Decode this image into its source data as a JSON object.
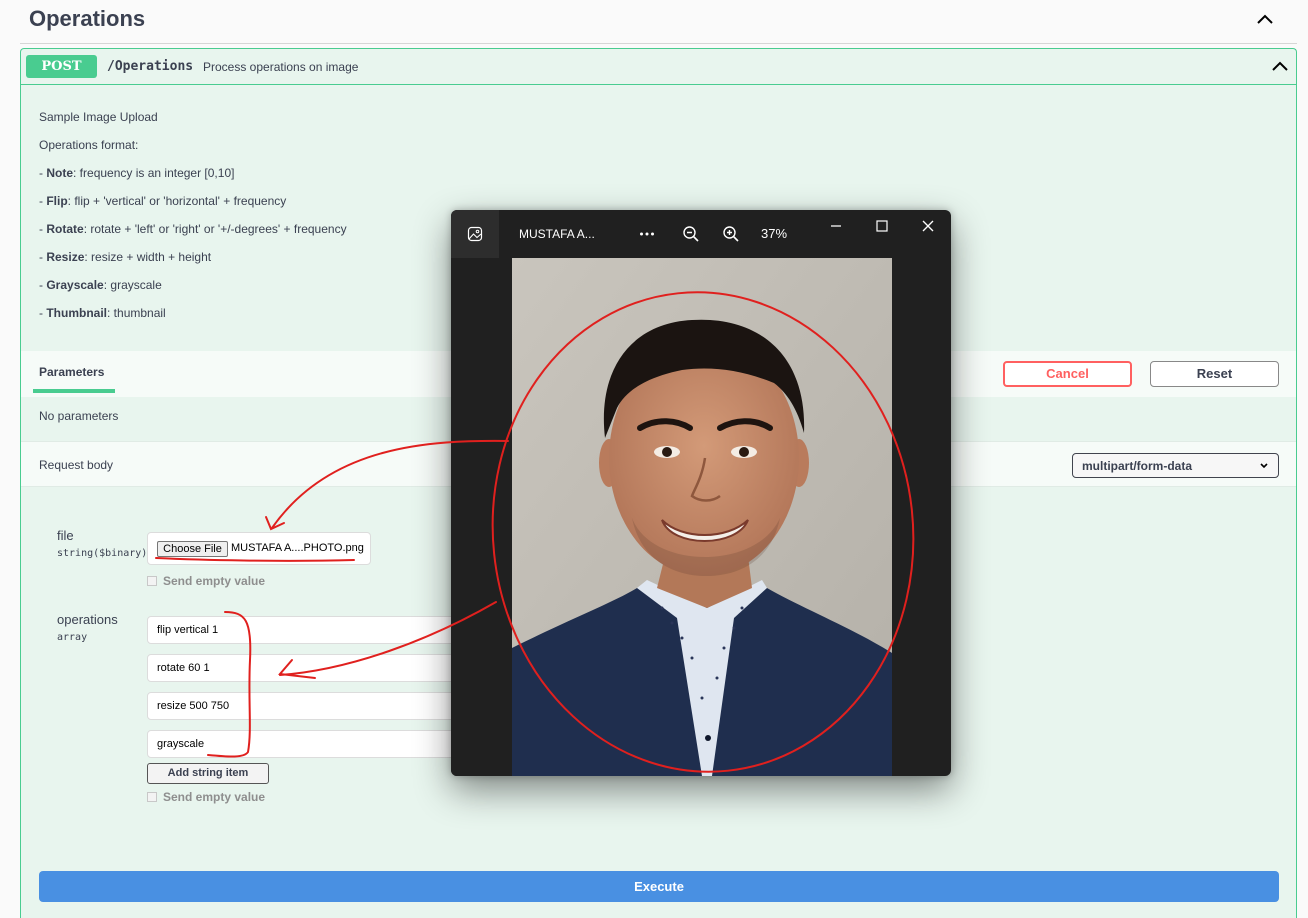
{
  "section": {
    "title": "Operations"
  },
  "endpoint": {
    "method": "POST",
    "path": "/Operations",
    "summary": "Process operations on image"
  },
  "description": {
    "intro": "Sample Image Upload",
    "format_label": "Operations format:",
    "items": [
      {
        "name": "Note",
        "text": ": frequency is an integer [0,10]"
      },
      {
        "name": "Flip",
        "text": ": flip + 'vertical' or 'horizontal' + frequency"
      },
      {
        "name": "Rotate",
        "text": ": rotate + 'left' or 'right' or '+/-degrees' + frequency"
      },
      {
        "name": "Resize",
        "text": ": resize + width + height"
      },
      {
        "name": "Grayscale",
        "text": ": grayscale"
      },
      {
        "name": "Thumbnail",
        "text": ": thumbnail"
      }
    ]
  },
  "parameters": {
    "tab_label": "Parameters",
    "cancel_label": "Cancel",
    "reset_label": "Reset",
    "empty_text": "No parameters"
  },
  "request_body": {
    "label": "Request body",
    "content_type": "multipart/form-data"
  },
  "fields": {
    "file": {
      "name": "file",
      "type": "string($binary)",
      "choose_label": "Choose File",
      "file_name": "MUSTAFA A....PHOTO.png",
      "send_empty_label": "Send empty value"
    },
    "operations": {
      "name": "operations",
      "type": "array",
      "items": [
        "flip vertical 1",
        "rotate 60 1",
        "resize 500 750",
        "grayscale"
      ],
      "add_item_label": "Add string item",
      "send_empty_label": "Send empty value"
    }
  },
  "execute_label": "Execute",
  "viewer": {
    "file_name": "MUSTAFA A...",
    "zoom": "37%",
    "icons": [
      "photos-app-icon",
      "more-icon",
      "zoom-out-icon",
      "zoom-in-icon",
      "minimize-icon",
      "maximize-icon",
      "close-icon"
    ]
  },
  "colors": {
    "post_green": "#49cc90",
    "execute_blue": "#4990e2",
    "cancel_red": "#ff6060",
    "annotation_red": "#e0201e"
  }
}
